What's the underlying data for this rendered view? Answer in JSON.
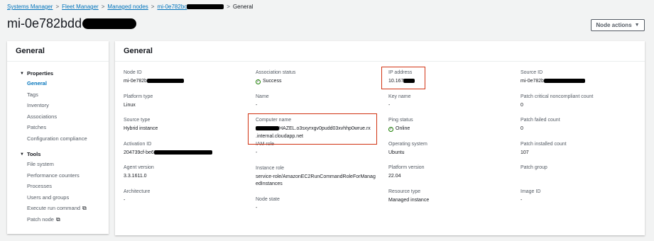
{
  "breadcrumb": {
    "items": [
      "Systems Manager",
      "Fleet Manager",
      "Managed nodes",
      "mi-0e782bc",
      "General"
    ]
  },
  "page": {
    "title": "mi-0e782bdd",
    "node_actions_label": "Node actions"
  },
  "sidebar": {
    "title": "General",
    "groups": [
      {
        "title": "Properties",
        "items": [
          "General",
          "Tags",
          "Inventory",
          "Associations",
          "Patches",
          "Configuration compliance"
        ]
      },
      {
        "title": "Tools",
        "items": [
          "File system",
          "Performance counters",
          "Processes",
          "Users and groups",
          "Execute run command",
          "Patch node"
        ]
      }
    ]
  },
  "main": {
    "title": "General",
    "columns": [
      [
        {
          "label": "Node ID",
          "value": "mi-0e782b"
        },
        {
          "label": "Platform type",
          "value": "Linux"
        },
        {
          "label": "Source type",
          "value": "Hybrid instance"
        },
        {
          "label": "Activation ID",
          "value": "204739cf-be6"
        },
        {
          "label": "Agent version",
          "value": "3.3.1611.0"
        },
        {
          "label": "Architecture",
          "value": "-"
        }
      ],
      [
        {
          "label": "Association status",
          "value": "Success"
        },
        {
          "label": "Name",
          "value": "-"
        },
        {
          "label": "Computer name",
          "value": "HAZEL.o3sxyrxgv0pudd03xvhhp0wrue.rx",
          "value2": ".internal.cloudapp.net"
        },
        {
          "label": "IAM role",
          "value": "-"
        },
        {
          "label": "Instance role",
          "value": "service-role/AmazonEC2RunCommandRoleForManagedInstances"
        },
        {
          "label": "Node state",
          "value": "-"
        }
      ],
      [
        {
          "label": "IP address",
          "value": "10.167"
        },
        {
          "label": "Key name",
          "value": "-"
        },
        {
          "label": "Ping status",
          "value": "Online"
        },
        {
          "label": "Operating system",
          "value": "Ubuntu"
        },
        {
          "label": "Platform version",
          "value": "22.04"
        },
        {
          "label": "Resource type",
          "value": "Managed instance"
        }
      ],
      [
        {
          "label": "Source ID",
          "value": "mi-0e782b"
        },
        {
          "label": "Patch critical noncompliant count",
          "value": "0"
        },
        {
          "label": "Patch failed count",
          "value": "0"
        },
        {
          "label": "Patch installed count",
          "value": "107"
        },
        {
          "label": "Patch group",
          "value": ""
        },
        {
          "label": "Image ID",
          "value": "-"
        }
      ]
    ]
  }
}
